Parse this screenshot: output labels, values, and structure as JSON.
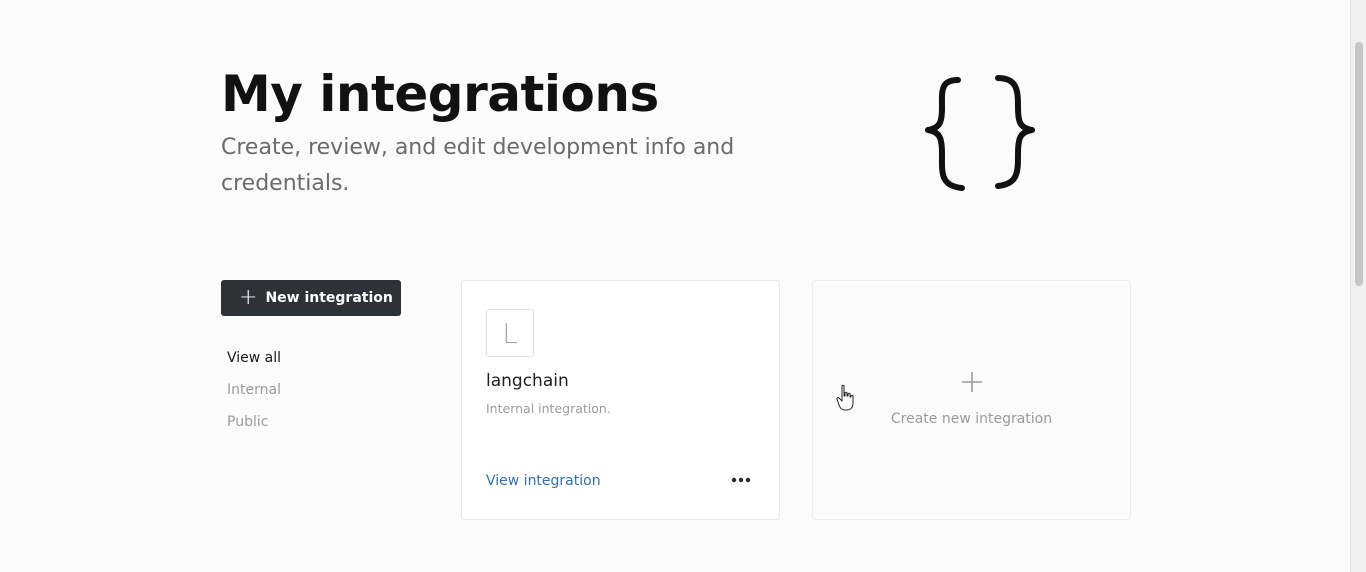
{
  "header": {
    "title": "My integrations",
    "subtitle": "Create, review, and edit development info and credentials."
  },
  "toolbar": {
    "new_integration_label": "New integration"
  },
  "filters": [
    {
      "label": "View all",
      "active": true
    },
    {
      "label": "Internal",
      "active": false
    },
    {
      "label": "Public",
      "active": false
    }
  ],
  "integrations": [
    {
      "avatar_letter": "L",
      "name": "langchain",
      "description": "Internal integration.",
      "link_label": "View integration"
    }
  ],
  "create_card": {
    "label": "Create new integration"
  },
  "icons": {
    "hero": "curly-braces-icon",
    "add": "plus-icon",
    "more": "ellipsis-icon",
    "cursor": "hand-pointer-icon"
  },
  "colors": {
    "primary_button": "#2e3236",
    "link": "#2f6fb7",
    "background": "#fbfbfb"
  }
}
